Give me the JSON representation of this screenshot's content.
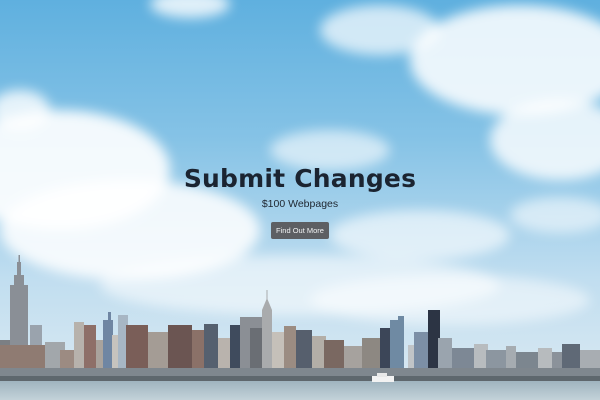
{
  "hero": {
    "title": "Submit Changes",
    "subtitle": "$100 Webpages",
    "button_label": "Find Out More"
  },
  "colors": {
    "title": "#1b2431",
    "button_bg": "#5d5f63",
    "button_text": "#f2f3f4",
    "sky_top": "#5fb0df",
    "water": "#b3c6cf"
  },
  "background": {
    "description_icon": "city-skyline-photo"
  }
}
